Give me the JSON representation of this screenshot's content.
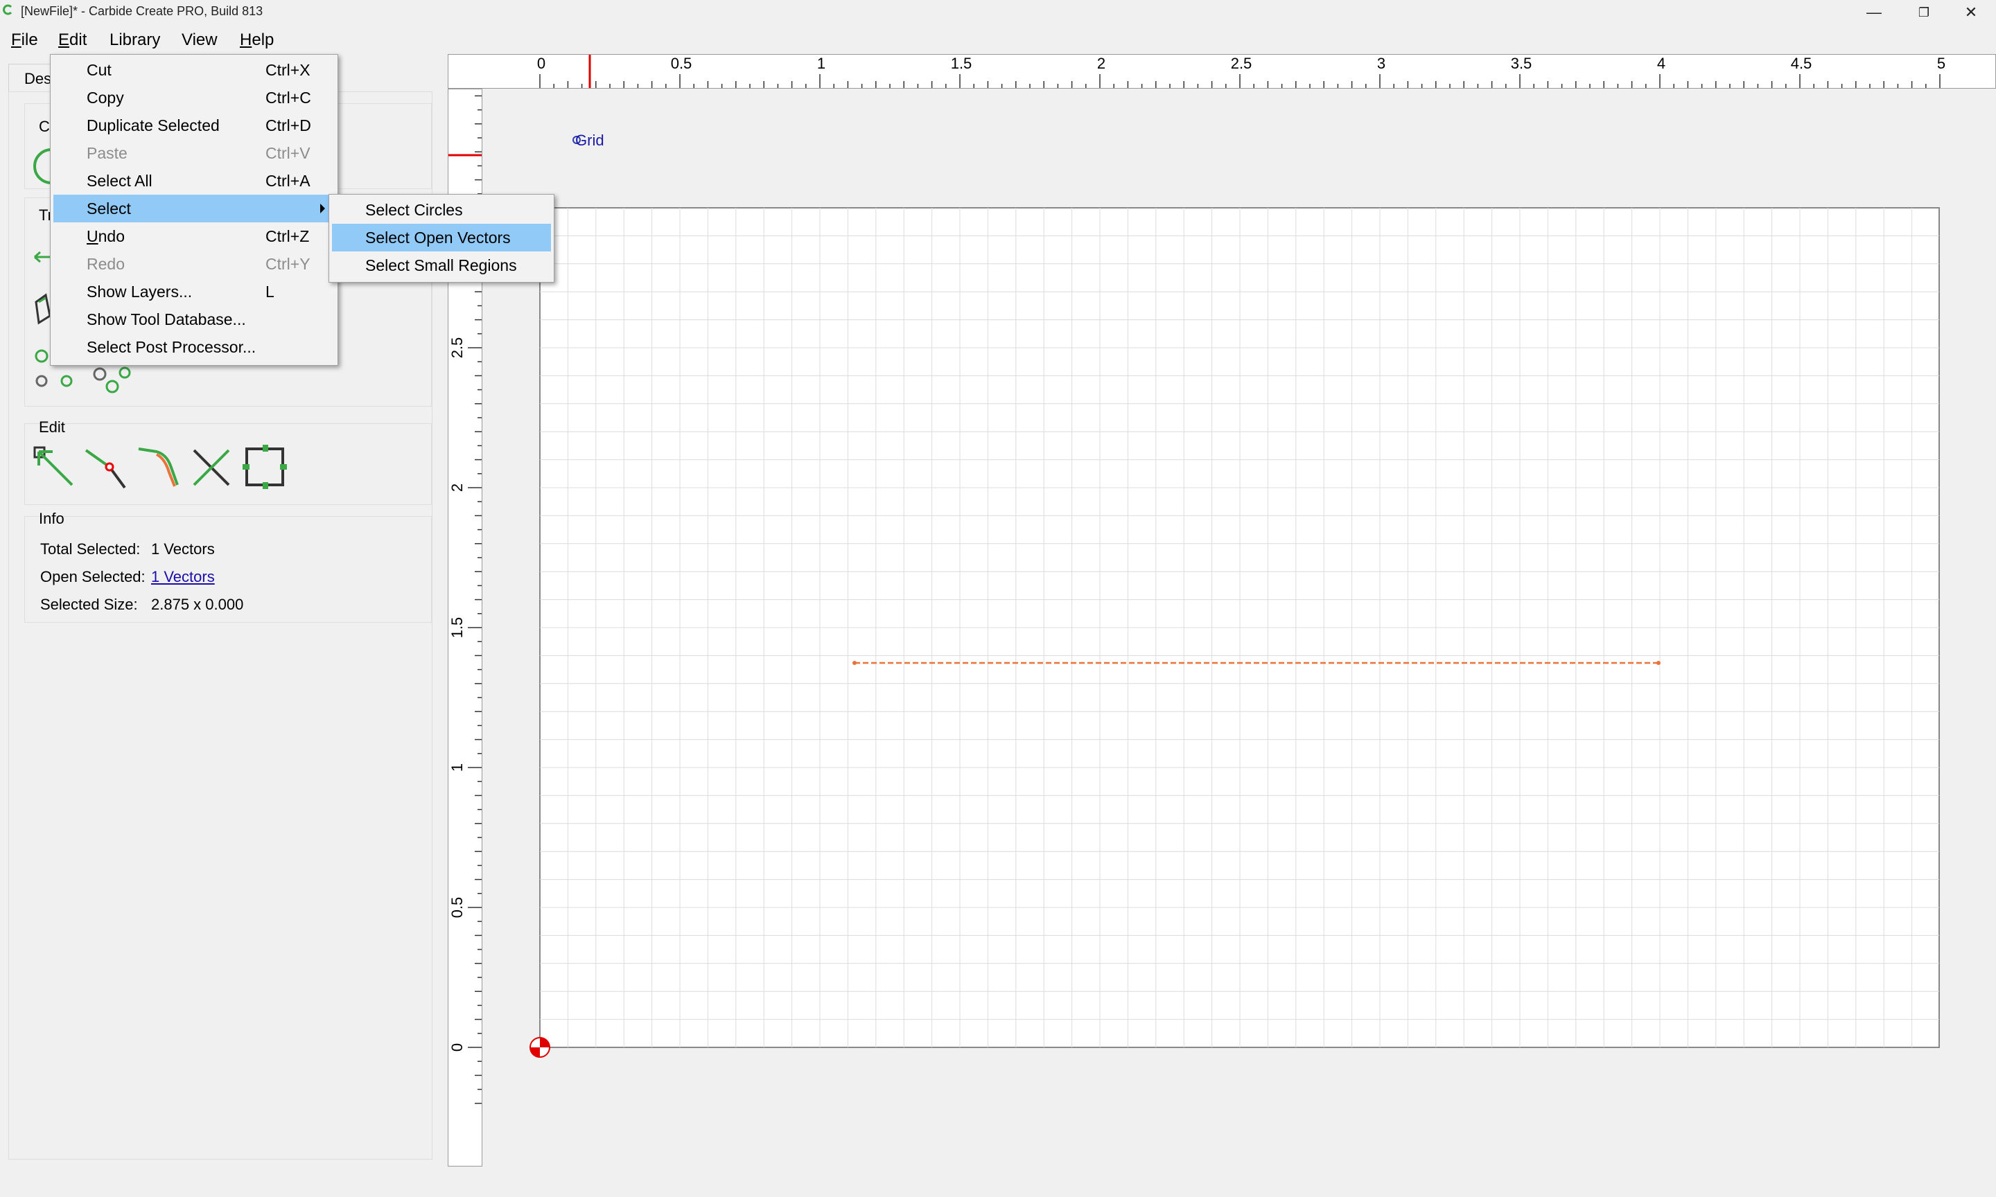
{
  "window": {
    "title": "[NewFile]* - Carbide Create PRO, Build 813",
    "buttons": {
      "minimize": "—",
      "restore": "❐",
      "close": "✕"
    }
  },
  "menubar": {
    "items": [
      {
        "label": "File",
        "underline": "F"
      },
      {
        "label": "Edit",
        "underline": "E"
      },
      {
        "label": "Library"
      },
      {
        "label": "View"
      },
      {
        "label": "Help",
        "underline": "H"
      }
    ]
  },
  "edit_menu": {
    "items": [
      {
        "label": "Cut",
        "shortcut": "Ctrl+X",
        "enabled": true
      },
      {
        "label": "Copy",
        "shortcut": "Ctrl+C",
        "enabled": true
      },
      {
        "label": "Duplicate Selected",
        "shortcut": "Ctrl+D",
        "enabled": true
      },
      {
        "label": "Paste",
        "shortcut": "Ctrl+V",
        "enabled": false
      },
      {
        "label": "Select All",
        "shortcut": "Ctrl+A",
        "enabled": true
      },
      {
        "label": "Select",
        "shortcut": "",
        "enabled": true,
        "submenu": true,
        "highlighted": true
      },
      {
        "label": "Undo",
        "shortcut": "Ctrl+Z",
        "enabled": true
      },
      {
        "label": "Redo",
        "shortcut": "Ctrl+Y",
        "enabled": false
      },
      {
        "label": "Show Layers...",
        "shortcut": "L",
        "enabled": true
      },
      {
        "label": "Show Tool Database...",
        "shortcut": "",
        "enabled": true
      },
      {
        "label": "Select Post Processor...",
        "shortcut": "",
        "enabled": true
      }
    ]
  },
  "select_submenu": {
    "items": [
      {
        "label": "Select Circles",
        "highlighted": false
      },
      {
        "label": "Select Open Vectors",
        "highlighted": true
      },
      {
        "label": "Select Small Regions",
        "highlighted": false
      }
    ]
  },
  "left_panel": {
    "tab_label": "Des",
    "create_label": "Cre",
    "transform_label": "Tra",
    "edit_label": "Edit",
    "info": {
      "title": "Info",
      "total_selected_label": "Total Selected:",
      "total_selected_value": "1 Vectors",
      "open_selected_label": "Open Selected:",
      "open_selected_value": "1 Vectors",
      "selected_size_label": "Selected Size:",
      "selected_size_value": "2.875 x 0.000"
    }
  },
  "canvas": {
    "grid_label": "Grid",
    "ruler_top_labels": [
      "0",
      "0.5",
      "1",
      "1.5",
      "2",
      "2.5",
      "3",
      "3.5",
      "4",
      "4.5",
      "5"
    ],
    "ruler_left_labels": [
      "2.5",
      "2",
      "1.5",
      "1",
      "0.5",
      "0"
    ],
    "colors": {
      "vector": "#e8743b",
      "marker": "#e00000",
      "grid": "#d9d9d9",
      "highlight": "#91c9f7"
    }
  }
}
